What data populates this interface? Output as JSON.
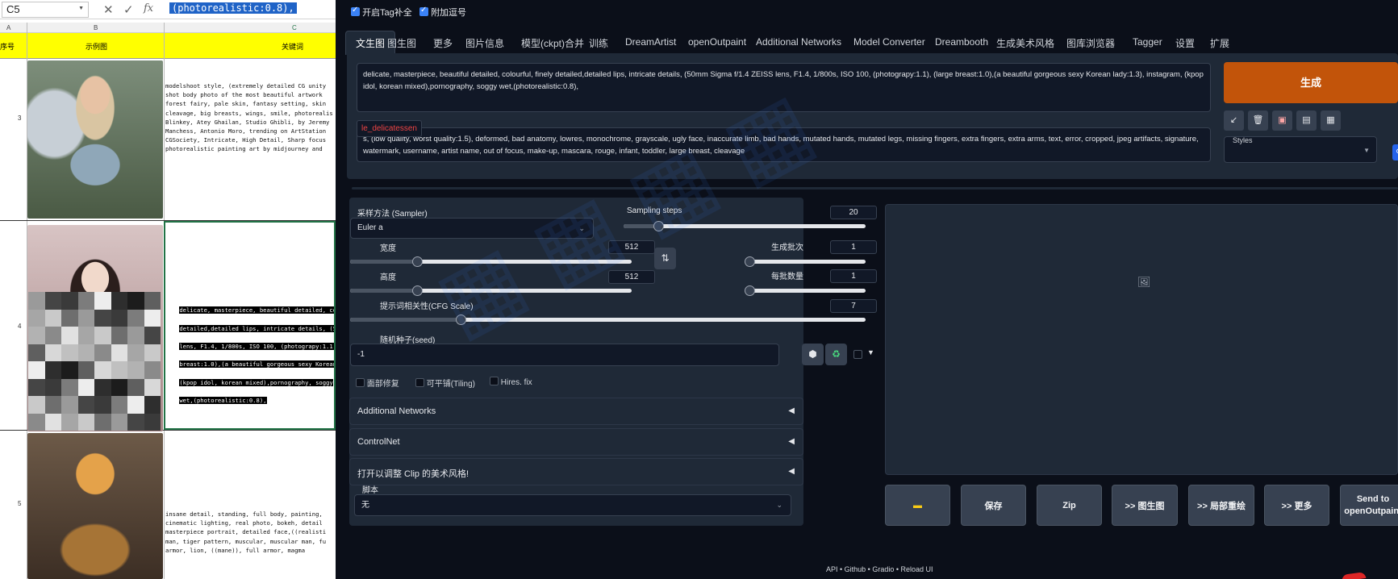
{
  "excel": {
    "namebox": "C5",
    "fx_label": "fx",
    "formula_text": "(photorealistic:0.8),",
    "columns": [
      "A",
      "B",
      "C"
    ],
    "header": {
      "a": "序号",
      "b": "示例图",
      "c": "关键词"
    },
    "rows": [
      {
        "num": "3",
        "prompt": "modelshoot style, (extremely detailed CG unity\nshot body photo of the most beautiful artwork\nforest fairy, pale skin, fantasy setting, skin\ncleavage, big breasts, wings, smile, photorealis\nBlinkey, Atey Ghailan, Studio Ghibli, by Jeremy\nManchess, Antonio Moro, trending on ArtStation\nCGSociety, Intricate, High Detail, Sharp focus\nphotorealistic painting art by midjourney and"
      },
      {
        "num": "4",
        "prompt_lines": [
          "delicate, masterpiece, beautiful detailed, colo",
          "detailed,detailed lips, intricate details, (50",
          "lens, F1.4, 1/800s, ISO 100, (photograpy:1.1),",
          "breast:1.0),(a beautiful gorgeous sexy Korean",
          "(kpop idol, korean mixed),pornography, soggy",
          "wet,(photorealistic:0.8),"
        ]
      },
      {
        "num": "5",
        "prompt": "insane detail, standing, full body, painting,\ncinematic lighting, real photo, bokeh, detail\nmasterpiece portrait, detailed face,((realisti\nman, tiger pattern, muscular, muscular man, fu\narmor, lion, ((mane)), full armor, magma"
      }
    ]
  },
  "webui": {
    "toggles": {
      "tag_complete": "开启Tag补全",
      "add_comma": "附加逗号"
    },
    "tabs": [
      "文生图",
      "图生图",
      "更多",
      "图片信息",
      "模型(ckpt)合并",
      "训练",
      "DreamArtist",
      "openOutpaint",
      "Additional Networks",
      "Model Converter",
      "Dreambooth",
      "生成美术风格",
      "图库浏览器",
      "Tagger",
      "设置",
      "扩展"
    ],
    "prompt": "delicate, masterpiece, beautiful detailed, colourful, finely detailed,detailed lips, intricate details, (50mm Sigma f/1.4 ZEISS lens, F1.4, 1/800s, ISO 100,  (photograpy:1.1), (large breast:1.0),(a beautiful gorgeous sexy Korean lady:1.3), instagram, (kpop idol, korean mixed),pornography, soggy wet,(photorealistic:0.8),",
    "neg_tag": "le_delicatessen",
    "negative_prompt": "                s, (low quality, worst quality:1.5), deformed, bad anatomy, lowres, monochrome, grayscale, ugly face, inaccurate limb, bad hands, mutated hands, mutated legs, missing fingers, extra fingers, extra arms, text, error, cropped, jpeg artifacts, signature, watermark, username, artist name, out of focus, make-up, mascara, rouge, infant, toddler, large breast, cleavage",
    "generate": "生成",
    "styles_label": "Styles",
    "sampler": {
      "label": "采样方法 (Sampler)",
      "value": "Euler a"
    },
    "steps": {
      "label": "Sampling steps",
      "value": "20",
      "fraction": 0.13
    },
    "width": {
      "label": "宽度",
      "value": "512",
      "fraction": 0.23
    },
    "height": {
      "label": "高度",
      "value": "512",
      "fraction": 0.23
    },
    "batch_count": {
      "label": "生成批次",
      "value": "1",
      "fraction": 0.0
    },
    "batch_size": {
      "label": "每批数量",
      "value": "1",
      "fraction": 0.0
    },
    "cfg": {
      "label": "提示词相关性(CFG Scale)",
      "value": "7",
      "fraction": 0.21
    },
    "seed": {
      "label": "随机种子(seed)",
      "value": "-1"
    },
    "checks": {
      "face": "面部修复",
      "tiling": "可平铺(Tiling)",
      "hires": "Hires. fix"
    },
    "accordions": {
      "networks": "Additional Networks",
      "controlnet": "ControlNet",
      "clip": "打开以调整 Clip 的美术风格!",
      "script_label": "脚本",
      "script_value": "无"
    },
    "output_buttons": {
      "save": "保存",
      "zip": "Zip",
      "img2img": ">> 图生图",
      "inpaint": ">> 局部重绘",
      "extras": ">> 更多",
      "outpaint": "Send to openOutpaint"
    },
    "footer": "API  •  Github  •  Gradio  •  Reload UI"
  }
}
